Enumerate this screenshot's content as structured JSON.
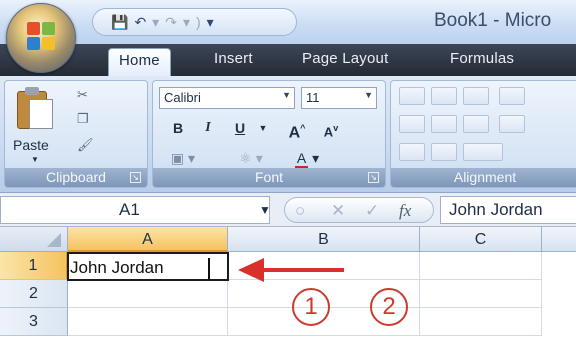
{
  "titlebar": {
    "title": "Book1 - Micro",
    "quick_access": [
      "save-icon",
      "undo-icon",
      "redo-icon",
      "customize-icon"
    ]
  },
  "tabs": [
    {
      "label": "Home",
      "active": true
    },
    {
      "label": "Insert",
      "active": false
    },
    {
      "label": "Page Layout",
      "active": false
    },
    {
      "label": "Formulas",
      "active": false
    }
  ],
  "ribbon": {
    "clipboard": {
      "label": "Clipboard",
      "paste_label": "Paste"
    },
    "font": {
      "label": "Font",
      "font_name": "Calibri",
      "font_size": "11",
      "bold": "B",
      "italic": "I",
      "underline": "U",
      "grow": "A",
      "shrink": "A",
      "font_color_letter": "A"
    },
    "alignment": {
      "label": "Alignment"
    }
  },
  "formula_bar": {
    "name_box": "A1",
    "fx_label": "fx",
    "content": "John Jordan"
  },
  "sheet": {
    "columns": [
      "A",
      "B",
      "C"
    ],
    "rows": [
      "1",
      "2",
      "3"
    ],
    "active_cell": "A1",
    "a1_text": "John Jordan"
  },
  "annotations": {
    "circle_1": "1",
    "circle_2": "2",
    "arrow_color": "#d8312b"
  },
  "colors": {
    "selected_header": "#f5c35f",
    "ribbon": "#c7d8ef",
    "tab_strip": "#2b3340"
  }
}
